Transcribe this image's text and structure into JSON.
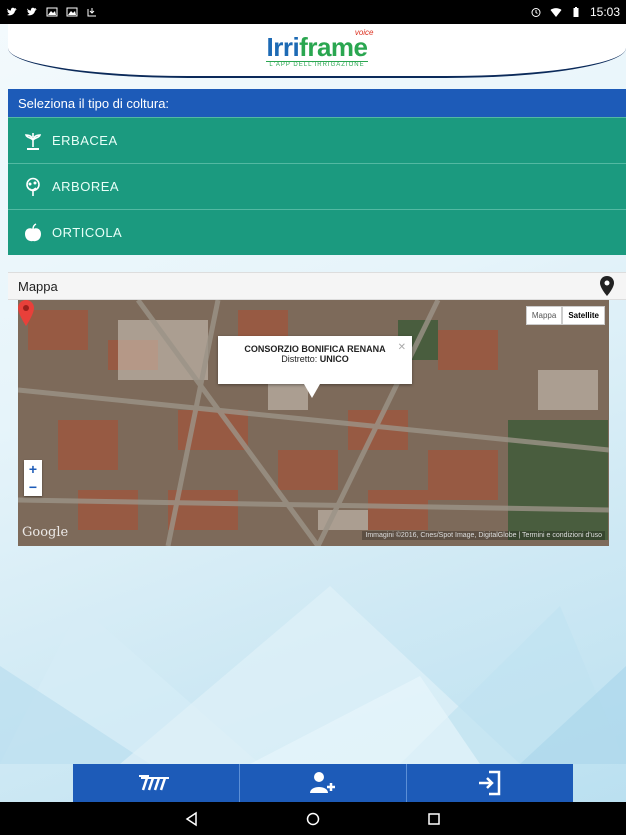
{
  "status_bar": {
    "time": "15:03",
    "left_icons": [
      "twitter-icon",
      "twitter-icon",
      "gallery-icon",
      "gallery-icon",
      "download-icon"
    ],
    "right_icons": [
      "alarm-icon",
      "wifi-icon",
      "battery-icon"
    ]
  },
  "header": {
    "logo_text_main": "Irri",
    "logo_text_accent": "frame",
    "logo_badge": "voice",
    "logo_tagline": "L'APP DELL'IRRIGAZIONE"
  },
  "crop_selection": {
    "prompt": "Seleziona il tipo di coltura:",
    "items": [
      {
        "label": "ERBACEA",
        "icon": "sprout-icon"
      },
      {
        "label": "ARBOREA",
        "icon": "tree-icon"
      },
      {
        "label": "ORTICOLA",
        "icon": "apple-icon"
      }
    ]
  },
  "map": {
    "title": "Mappa",
    "location_icon": "map-pin-icon",
    "type_options": [
      "Mappa",
      "Satellite"
    ],
    "selected_type": "Satellite",
    "info_title": "CONSORZIO BONIFICA RENANA",
    "info_district_label": "Distretto:",
    "info_district_value": "UNICO",
    "zoom_in": "+",
    "zoom_out": "−",
    "google_logo": "Google",
    "attribution": "Immagini ©2016, Cnes/Spot Image, DigitalGlobe | Termini e condizioni d'uso"
  },
  "bottom_nav": {
    "buttons": [
      {
        "icon": "irrigation-icon"
      },
      {
        "icon": "add-user-icon"
      },
      {
        "icon": "login-icon"
      }
    ]
  },
  "colors": {
    "primary_blue": "#1d5bb8",
    "crop_green": "#1b9a7f",
    "header_navy": "#0b2a5a"
  }
}
